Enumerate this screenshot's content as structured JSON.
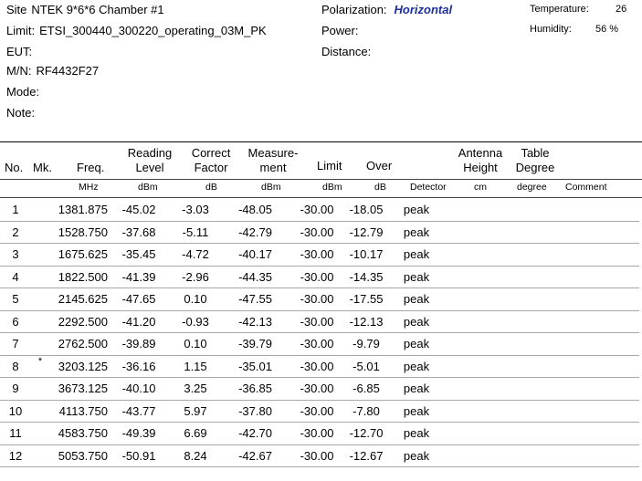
{
  "header": {
    "site_label": "Site",
    "site_value": "NTEK 9*6*6 Chamber #1",
    "limit_label": "Limit:",
    "limit_value": "ETSI_300440_300220_operating_03M_PK",
    "eut_label": "EUT:",
    "mn_label": "M/N:",
    "mn_value": "RF4432F27",
    "mode_label": "Mode:",
    "note_label": "Note:",
    "polarization_label": "Polarization:",
    "polarization_value": "Horizontal",
    "power_label": "Power:",
    "distance_label": "Distance:",
    "temperature_label": "Temperature:",
    "temperature_value": "26",
    "humidity_label": "Humidity:",
    "humidity_value": "56 %"
  },
  "columns": {
    "no": "No.",
    "mk": "Mk.",
    "freq": "Freq.",
    "reading_1": "Reading",
    "reading_2": "Level",
    "correct_1": "Correct",
    "correct_2": "Factor",
    "measure_1": "Measure-",
    "measure_2": "ment",
    "limit": "Limit",
    "over": "Over",
    "antenna_1": "Antenna",
    "antenna_2": "Height",
    "table_1": "Table",
    "table_2": "Degree"
  },
  "units": {
    "freq": "MHz",
    "reading": "dBm",
    "correct": "dB",
    "measure": "dBm",
    "limit": "dBm",
    "over": "dB",
    "detector": "Detector",
    "antenna": "cm",
    "degree": "degree",
    "comment": "Comment"
  },
  "rows": [
    {
      "no": "1",
      "mk": "",
      "freq": "1381.875",
      "reading": "-45.02",
      "correct": "-3.03",
      "measure": "-48.05",
      "limit": "-30.00",
      "over": "-18.05",
      "detector": "peak"
    },
    {
      "no": "2",
      "mk": "",
      "freq": "1528.750",
      "reading": "-37.68",
      "correct": "-5.11",
      "measure": "-42.79",
      "limit": "-30.00",
      "over": "-12.79",
      "detector": "peak"
    },
    {
      "no": "3",
      "mk": "",
      "freq": "1675.625",
      "reading": "-35.45",
      "correct": "-4.72",
      "measure": "-40.17",
      "limit": "-30.00",
      "over": "-10.17",
      "detector": "peak"
    },
    {
      "no": "4",
      "mk": "",
      "freq": "1822.500",
      "reading": "-41.39",
      "correct": "-2.96",
      "measure": "-44.35",
      "limit": "-30.00",
      "over": "-14.35",
      "detector": "peak"
    },
    {
      "no": "5",
      "mk": "",
      "freq": "2145.625",
      "reading": "-47.65",
      "correct": "0.10",
      "measure": "-47.55",
      "limit": "-30.00",
      "over": "-17.55",
      "detector": "peak"
    },
    {
      "no": "6",
      "mk": "",
      "freq": "2292.500",
      "reading": "-41.20",
      "correct": "-0.93",
      "measure": "-42.13",
      "limit": "-30.00",
      "over": "-12.13",
      "detector": "peak"
    },
    {
      "no": "7",
      "mk": "",
      "freq": "2762.500",
      "reading": "-39.89",
      "correct": "0.10",
      "measure": "-39.79",
      "limit": "-30.00",
      "over": "-9.79",
      "detector": "peak"
    },
    {
      "no": "8",
      "mk": "*",
      "freq": "3203.125",
      "reading": "-36.16",
      "correct": "1.15",
      "measure": "-35.01",
      "limit": "-30.00",
      "over": "-5.01",
      "detector": "peak"
    },
    {
      "no": "9",
      "mk": "",
      "freq": "3673.125",
      "reading": "-40.10",
      "correct": "3.25",
      "measure": "-36.85",
      "limit": "-30.00",
      "over": "-6.85",
      "detector": "peak"
    },
    {
      "no": "10",
      "mk": "",
      "freq": "4113.750",
      "reading": "-43.77",
      "correct": "5.97",
      "measure": "-37.80",
      "limit": "-30.00",
      "over": "-7.80",
      "detector": "peak"
    },
    {
      "no": "11",
      "mk": "",
      "freq": "4583.750",
      "reading": "-49.39",
      "correct": "6.69",
      "measure": "-42.70",
      "limit": "-30.00",
      "over": "-12.70",
      "detector": "peak"
    },
    {
      "no": "12",
      "mk": "",
      "freq": "5053.750",
      "reading": "-50.91",
      "correct": "8.24",
      "measure": "-42.67",
      "limit": "-30.00",
      "over": "-12.67",
      "detector": "peak"
    }
  ]
}
